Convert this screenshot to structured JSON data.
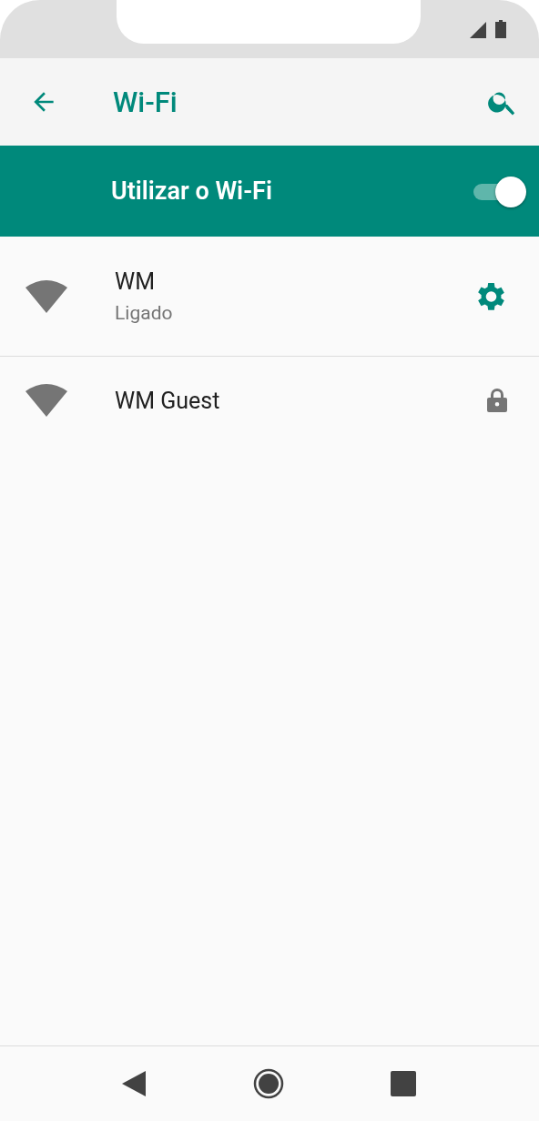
{
  "app_bar": {
    "title": "Wi-Fi"
  },
  "master_switch": {
    "label": "Utilizar o Wi-Fi",
    "on": true
  },
  "networks": [
    {
      "name": "WM",
      "status": "Ligado",
      "kind": "settings"
    },
    {
      "name": "WM Guest",
      "kind": "locked"
    }
  ]
}
